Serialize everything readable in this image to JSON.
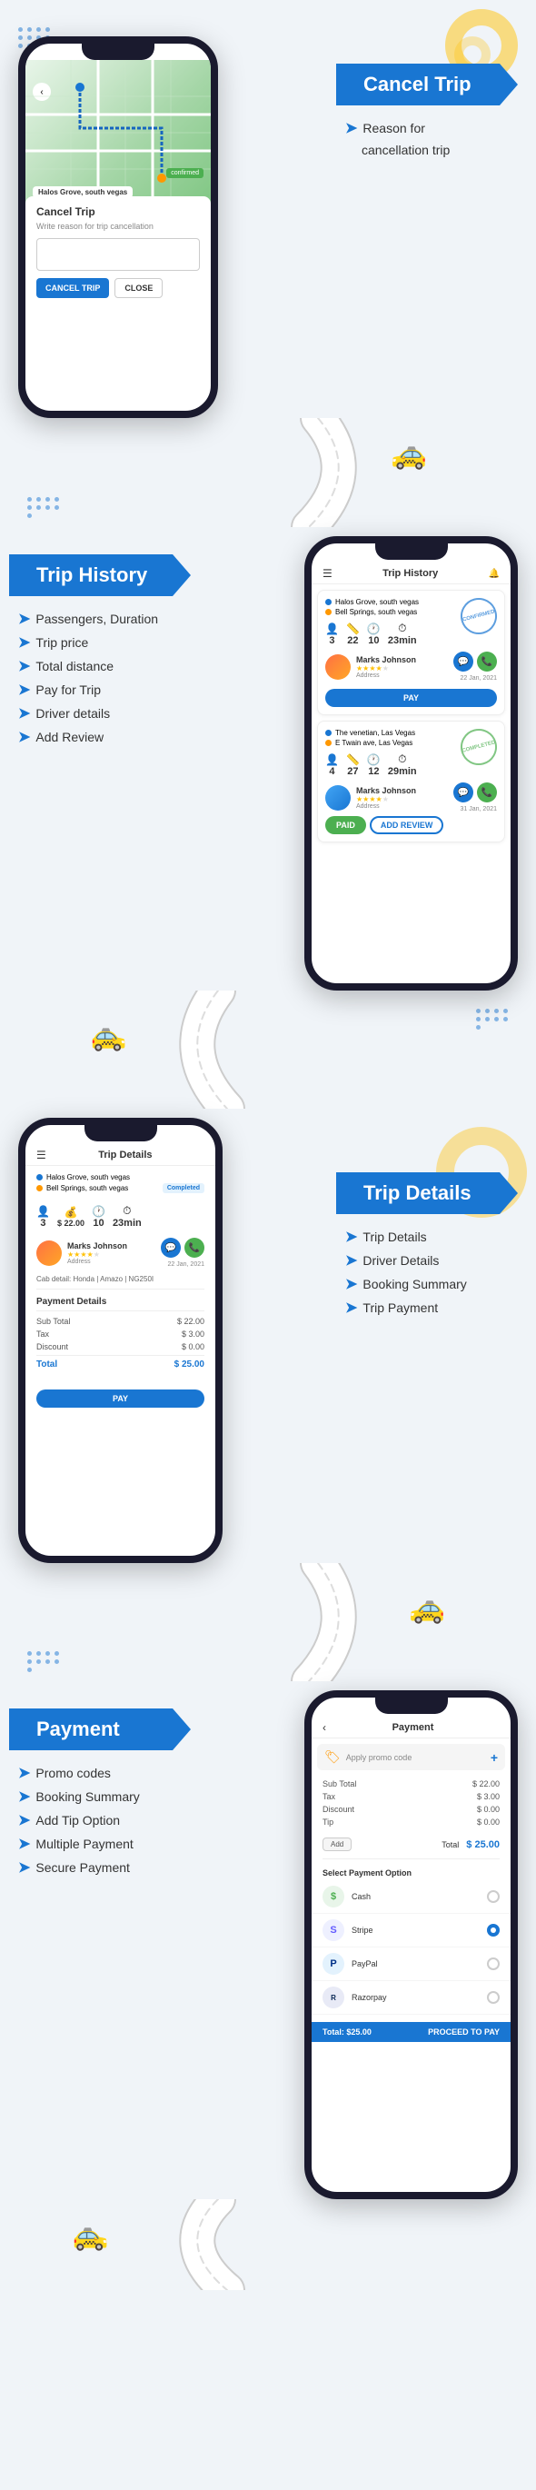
{
  "sections": {
    "cancel_trip": {
      "banner": "Cancel Trip",
      "desc_items": [
        "Reason for",
        "cancellation trip"
      ],
      "phone": {
        "location": "Halos Grove, south vegas",
        "confirmed": "confirmed",
        "modal_title": "Cancel Trip",
        "modal_subtitle": "Write reason for trip cancellation",
        "btn_cancel": "CANCEL TRIP",
        "btn_close": "CLOSE"
      }
    },
    "trip_history": {
      "banner": "Trip History",
      "desc_items": [
        "Passengers, Duration",
        "Trip price",
        "Total distance",
        "Pay for Trip",
        "Driver details",
        "Add Review"
      ],
      "phone": {
        "header": "Trip History",
        "trip1": {
          "from": "Halos Grove, south vegas",
          "to": "Bell Springs, south vegas",
          "passengers": "3",
          "distance": "22",
          "time": "10",
          "duration": "23min",
          "driver": "Marks Johnson",
          "address": "Address",
          "date": "22 Jan, 2021",
          "status": "PAY"
        },
        "trip2": {
          "from": "The venetian, Las Vegas",
          "to": "E Twain ave, Las Vegas",
          "passengers": "4",
          "distance": "27",
          "time": "12",
          "duration": "29min",
          "driver": "Marks Johnson",
          "address": "Address",
          "date": "31 Jan, 2021",
          "status": "PAID",
          "action": "ADD REVIEW"
        }
      }
    },
    "trip_details": {
      "banner": "Trip Details",
      "desc_items": [
        "Trip Details",
        "Driver Details",
        "Booking Summary",
        "Trip Payment"
      ],
      "phone": {
        "header": "Trip Details",
        "from": "Halos Grove, south vegas",
        "to": "Bell Springs, south vegas",
        "status": "Completed",
        "passengers": "3",
        "price": "$ 22.00",
        "time": "10",
        "duration": "23min",
        "driver": "Marks Johnson",
        "driver_address": "Address",
        "date": "22 Jan, 2021",
        "cab": "Honda | Amazo | NG250I",
        "payment": {
          "title": "Payment Details",
          "sub_total_label": "Sub Total",
          "sub_total": "$ 22.00",
          "tax_label": "Tax",
          "tax": "$ 3.00",
          "discount_label": "Discount",
          "discount": "$ 0.00",
          "total_label": "Total",
          "total": "$ 25.00"
        },
        "btn_pay": "PAY"
      }
    },
    "payment": {
      "banner": "Payment",
      "desc_items": [
        "Promo codes",
        "Booking Summary",
        "Add Tip Option",
        "Multiple Payment",
        "Secure Payment"
      ],
      "phone": {
        "header": "Payment",
        "promo_placeholder": "Apply promo code",
        "sub_total_label": "Sub Total",
        "sub_total": "$ 22.00",
        "tax_label": "Tax",
        "tax": "$ 3.00",
        "discount_label": "Discount",
        "discount": "$ 0.00",
        "tip_label": "Tip",
        "tip": "$ 0.00",
        "add_tip_btn": "Add",
        "total_label": "Total",
        "total": "$ 25.00",
        "select_payment_label": "Select Payment Option",
        "payment_options": [
          {
            "name": "Cash",
            "icon": "$",
            "color": "#4CAF50",
            "selected": false
          },
          {
            "name": "Stripe",
            "icon": "S",
            "color": "#635BFF",
            "selected": true
          },
          {
            "name": "PayPal",
            "icon": "P",
            "color": "#003087",
            "selected": false
          },
          {
            "name": "Razorpay",
            "icon": "R",
            "color": "#072654",
            "selected": false
          }
        ],
        "proceed_total": "Total: $25.00",
        "proceed_btn": "PROCEED TO PAY"
      }
    }
  }
}
